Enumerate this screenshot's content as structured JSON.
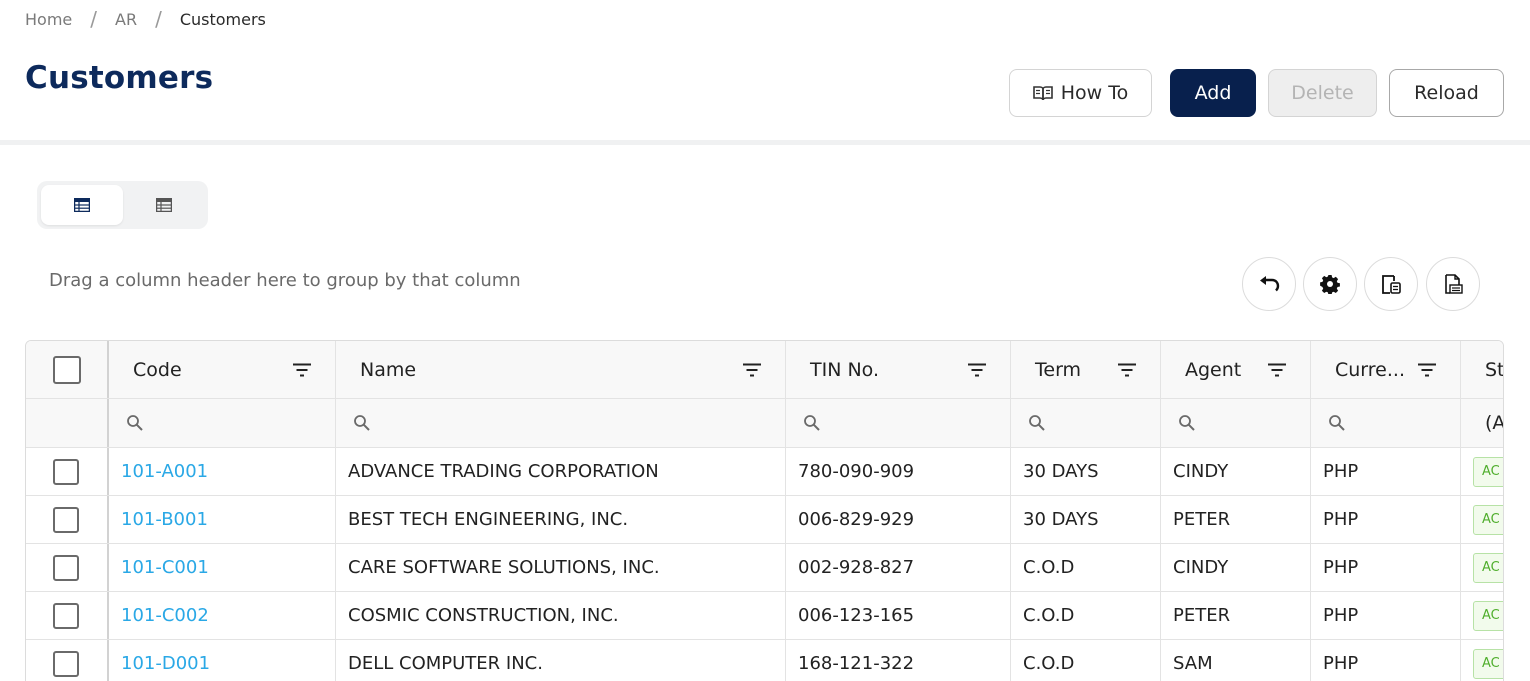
{
  "breadcrumb": {
    "items": [
      "Home",
      "AR",
      "Customers"
    ],
    "separator": "/"
  },
  "page": {
    "title": "Customers"
  },
  "toolbar": {
    "howto_label": "How To",
    "add_label": "Add",
    "delete_label": "Delete",
    "reload_label": "Reload"
  },
  "view_toggle": {
    "options": [
      "table-view-icon",
      "list-view-icon"
    ],
    "selected": 0
  },
  "grid_toolbar": {
    "group_hint": "Drag a column header here to group by that column",
    "icons": [
      "undo-icon",
      "gear-icon",
      "column-chooser-icon",
      "export-icon"
    ]
  },
  "grid": {
    "columns": [
      {
        "label": "Code"
      },
      {
        "label": "Name"
      },
      {
        "label": "TIN No."
      },
      {
        "label": "Term"
      },
      {
        "label": "Agent"
      },
      {
        "label": "Curre..."
      },
      {
        "label": "St"
      }
    ],
    "status_filter_text": "(A",
    "rows": [
      {
        "code": "101-A001",
        "name": "ADVANCE TRADING CORPORATION",
        "tin": "780-090-909",
        "term": "30 DAYS",
        "agent": "CINDY",
        "currency": "PHP",
        "status": "AC"
      },
      {
        "code": "101-B001",
        "name": "BEST TECH ENGINEERING, INC.",
        "tin": "006-829-929",
        "term": "30 DAYS",
        "agent": "PETER",
        "currency": "PHP",
        "status": "AC"
      },
      {
        "code": "101-C001",
        "name": "CARE SOFTWARE SOLUTIONS, INC.",
        "tin": "002-928-827",
        "term": "C.O.D",
        "agent": "CINDY",
        "currency": "PHP",
        "status": "AC"
      },
      {
        "code": "101-C002",
        "name": "COSMIC CONSTRUCTION, INC.",
        "tin": "006-123-165",
        "term": "C.O.D",
        "agent": "PETER",
        "currency": "PHP",
        "status": "AC"
      },
      {
        "code": "101-D001",
        "name": "DELL COMPUTER INC.",
        "tin": "168-121-322",
        "term": "C.O.D",
        "agent": "SAM",
        "currency": "PHP",
        "status": "AC"
      }
    ]
  },
  "colors": {
    "title": "#0d2a5c",
    "primary": "#08204d",
    "link": "#2aa8e6",
    "status_green": "#4fae2c"
  }
}
